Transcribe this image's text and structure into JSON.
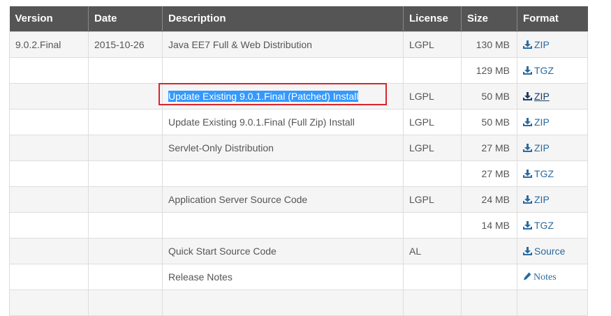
{
  "colors": {
    "header_bg": "#555555",
    "row_alt_bg": "#f5f5f5",
    "link": "#2b6aa0",
    "highlight": "#d9262b",
    "selection": "#3399ff"
  },
  "headers": [
    "Version",
    "Date",
    "Description",
    "License",
    "Size",
    "Format"
  ],
  "rows": [
    {
      "version": "9.0.2.Final",
      "date": "2015-10-26",
      "description": "Java EE7 Full & Web Distribution",
      "license": "LGPL",
      "size": "130 MB",
      "format": "ZIP",
      "icon": "download-icon"
    },
    {
      "version": "",
      "date": "",
      "description": "",
      "license": "",
      "size": "129 MB",
      "format": "TGZ",
      "icon": "download-icon"
    },
    {
      "version": "",
      "date": "",
      "description": "Update Existing 9.0.1.Final (Patched) Install",
      "license": "LGPL",
      "size": "50 MB",
      "format": "ZIP",
      "icon": "download-icon"
    },
    {
      "version": "",
      "date": "",
      "description": "Update Existing 9.0.1.Final (Full Zip) Install",
      "license": "LGPL",
      "size": "50 MB",
      "format": "ZIP",
      "icon": "download-icon"
    },
    {
      "version": "",
      "date": "",
      "description": "Servlet-Only Distribution",
      "license": "LGPL",
      "size": "27 MB",
      "format": "ZIP",
      "icon": "download-icon"
    },
    {
      "version": "",
      "date": "",
      "description": "",
      "license": "",
      "size": "27 MB",
      "format": "TGZ",
      "icon": "download-icon"
    },
    {
      "version": "",
      "date": "",
      "description": "Application Server Source Code",
      "license": "LGPL",
      "size": "24 MB",
      "format": "ZIP",
      "icon": "download-icon"
    },
    {
      "version": "",
      "date": "",
      "description": "",
      "license": "",
      "size": "14 MB",
      "format": "TGZ",
      "icon": "download-icon"
    },
    {
      "version": "",
      "date": "",
      "description": "Quick Start Source Code",
      "license": "AL",
      "size": "",
      "format": "Source",
      "icon": "download-icon"
    },
    {
      "version": "",
      "date": "",
      "description": "Release Notes",
      "license": "",
      "size": "",
      "format": "Notes",
      "icon": "pencil-icon"
    },
    {
      "version": "",
      "date": "",
      "description": "",
      "license": "",
      "size": "",
      "format": "",
      "icon": ""
    }
  ]
}
